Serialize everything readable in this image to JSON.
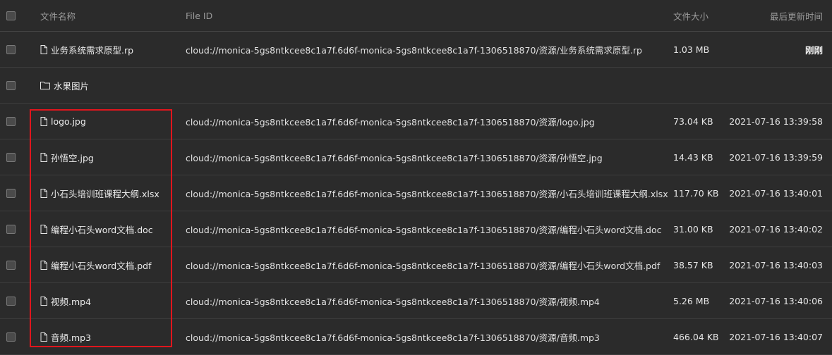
{
  "header": {
    "name": "文件名称",
    "file_id": "File ID",
    "size": "文件大小",
    "updated": "最后更新时间"
  },
  "rows": [
    {
      "type": "file",
      "name": "业务系统需求原型.rp",
      "file_id": "cloud://monica-5gs8ntkcee8c1a7f.6d6f-monica-5gs8ntkcee8c1a7f-1306518870/资源/业务系统需求原型.rp",
      "size": "1.03 MB",
      "updated": "刚刚"
    },
    {
      "type": "folder",
      "name": "水果图片",
      "file_id": "",
      "size": "",
      "updated": ""
    },
    {
      "type": "file",
      "name": "logo.jpg",
      "file_id": "cloud://monica-5gs8ntkcee8c1a7f.6d6f-monica-5gs8ntkcee8c1a7f-1306518870/资源/logo.jpg",
      "size": "73.04 KB",
      "updated": "2021-07-16 13:39:58"
    },
    {
      "type": "file",
      "name": "孙悟空.jpg",
      "file_id": "cloud://monica-5gs8ntkcee8c1a7f.6d6f-monica-5gs8ntkcee8c1a7f-1306518870/资源/孙悟空.jpg",
      "size": "14.43 KB",
      "updated": "2021-07-16 13:39:59"
    },
    {
      "type": "file",
      "name": "小石头培训班课程大纲.xlsx",
      "file_id": "cloud://monica-5gs8ntkcee8c1a7f.6d6f-monica-5gs8ntkcee8c1a7f-1306518870/资源/小石头培训班课程大纲.xlsx",
      "size": "117.70 KB",
      "updated": "2021-07-16 13:40:01"
    },
    {
      "type": "file",
      "name": "编程小石头word文档.doc",
      "file_id": "cloud://monica-5gs8ntkcee8c1a7f.6d6f-monica-5gs8ntkcee8c1a7f-1306518870/资源/编程小石头word文档.doc",
      "size": "31.00 KB",
      "updated": "2021-07-16 13:40:02"
    },
    {
      "type": "file",
      "name": "编程小石头word文档.pdf",
      "file_id": "cloud://monica-5gs8ntkcee8c1a7f.6d6f-monica-5gs8ntkcee8c1a7f-1306518870/资源/编程小石头word文档.pdf",
      "size": "38.57 KB",
      "updated": "2021-07-16 13:40:03"
    },
    {
      "type": "file",
      "name": "视频.mp4",
      "file_id": "cloud://monica-5gs8ntkcee8c1a7f.6d6f-monica-5gs8ntkcee8c1a7f-1306518870/资源/视频.mp4",
      "size": "5.26 MB",
      "updated": "2021-07-16 13:40:06"
    },
    {
      "type": "file",
      "name": "音频.mp3",
      "file_id": "cloud://monica-5gs8ntkcee8c1a7f.6d6f-monica-5gs8ntkcee8c1a7f-1306518870/资源/音频.mp3",
      "size": "466.04 KB",
      "updated": "2021-07-16 13:40:07"
    }
  ],
  "icons": {
    "file": "file-icon",
    "folder": "folder-icon"
  },
  "colors": {
    "background": "#2b2b2b",
    "highlight": "#e0161d"
  }
}
